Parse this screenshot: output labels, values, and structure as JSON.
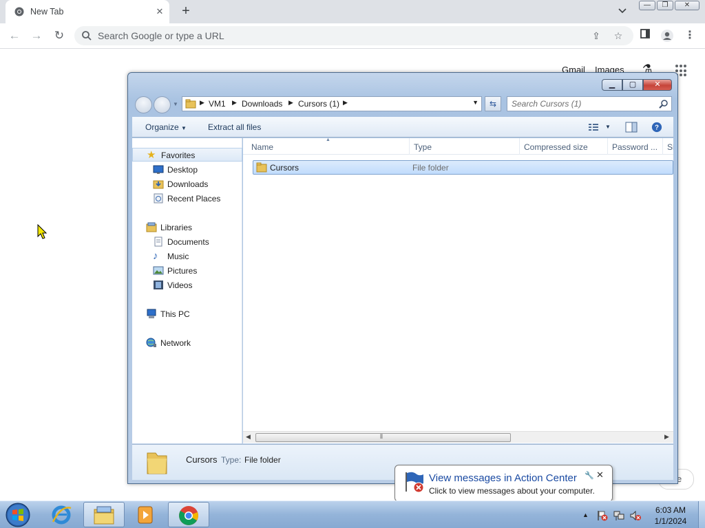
{
  "chrome": {
    "tab_title": "New Tab",
    "omnibox_placeholder": "Search Google or type a URL",
    "ntp_links": {
      "gmail": "Gmail",
      "images": "Images"
    }
  },
  "explorer": {
    "breadcrumb": [
      "VM1",
      "Downloads",
      "Cursors (1)"
    ],
    "search_placeholder": "Search Cursors (1)",
    "toolbar": {
      "organize": "Organize",
      "extract": "Extract all files"
    },
    "nav": {
      "favorites": "Favorites",
      "desktop": "Desktop",
      "downloads": "Downloads",
      "recent_places": "Recent Places",
      "libraries": "Libraries",
      "documents": "Documents",
      "music": "Music",
      "pictures": "Pictures",
      "videos": "Videos",
      "this_pc": "This PC",
      "network": "Network"
    },
    "columns": [
      "Name",
      "Type",
      "Compressed size",
      "Password ...",
      "Si"
    ],
    "files": [
      {
        "name": "Cursors",
        "type": "File folder"
      }
    ],
    "details": {
      "name": "Cursors",
      "type_label": "Type:",
      "type_value": "File folder"
    }
  },
  "balloon": {
    "title": "View messages in Action Center",
    "text": "Click to view messages about your computer.",
    "hidden_fragment": "e"
  },
  "taskbar": {
    "time": "6:03 AM",
    "date": "1/1/2024"
  },
  "colors": {
    "chrome_tabbar": "#dee1e6",
    "taskbar": "#94b4d9",
    "selection": "#c1dcfc",
    "balloon_title": "#1a4aa2"
  }
}
